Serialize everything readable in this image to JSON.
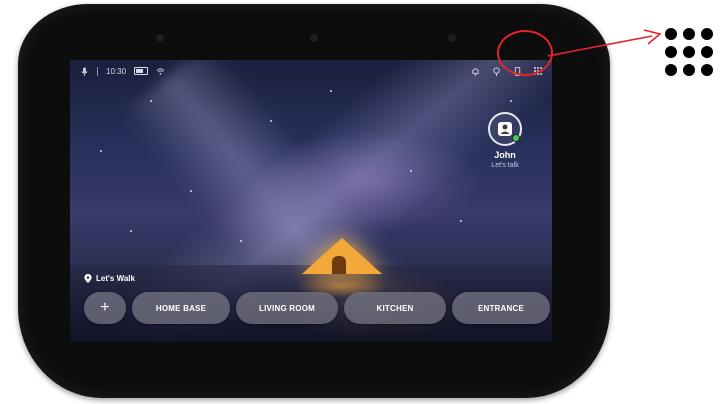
{
  "status_bar": {
    "time": "10:30",
    "left_icons": [
      "microphone-icon",
      "battery-icon",
      "wifi-icon"
    ],
    "right_icons": [
      "bell-icon",
      "lightbulb-icon",
      "phone-icon",
      "menu-dots-icon"
    ]
  },
  "user": {
    "name": "John",
    "subtitle": "Let's talk",
    "status": "online"
  },
  "location": {
    "label": "Let's Walk"
  },
  "rooms": {
    "add_label": "+",
    "items": [
      "HOME BASE",
      "LIVING ROOM",
      "KITCHEN",
      "ENTRANCE"
    ]
  },
  "annotation": {
    "circle_color": "#e3242b",
    "arrow_color": "#e3242b",
    "target": "menu-dots-icon"
  },
  "colors": {
    "bezel": "#0d0d0d",
    "pill": "#787887",
    "tent": "#f2a93a",
    "online": "#3ccf5a"
  }
}
